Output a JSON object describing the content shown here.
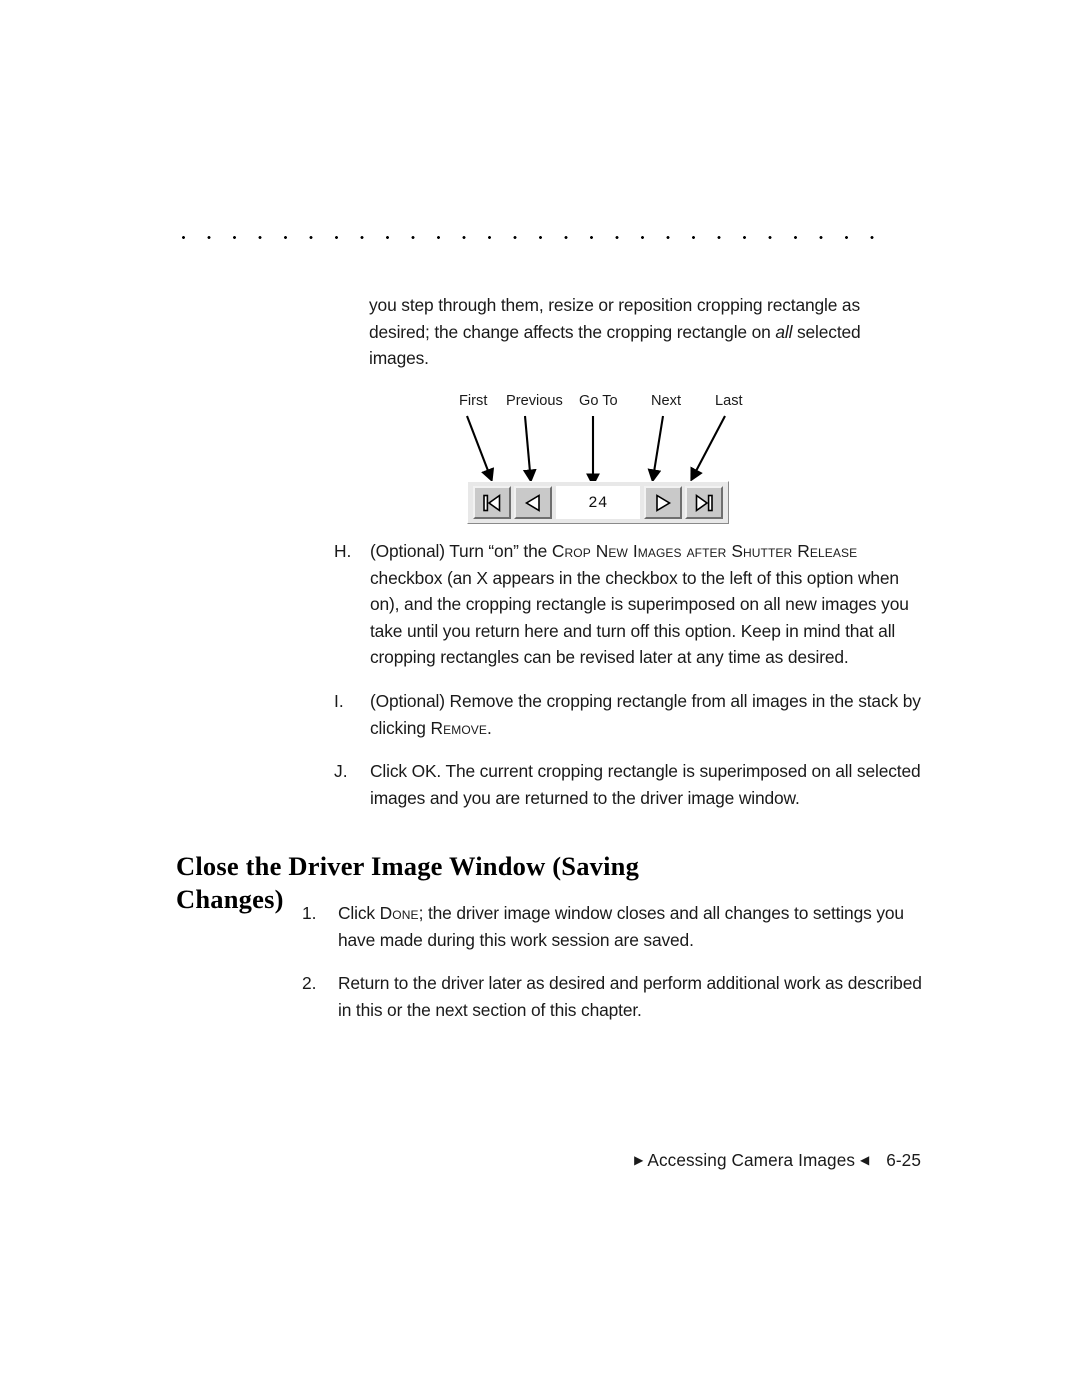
{
  "page": {
    "footer_prefix_icon": "triangle-right-icon",
    "footer_text": "Accessing Camera Images",
    "footer_suffix_icon": "triangle-left-icon",
    "page_number": "6-25"
  },
  "intro": {
    "line_1": "you step through them, resize or reposition cropping rectangle as",
    "line_2_a": "desired; the change affects the cropping rectangle on ",
    "line_2_em": "all",
    "line_2_b": " selected",
    "line_3": "images."
  },
  "figure": {
    "labels": [
      {
        "id": "first",
        "text": "First"
      },
      {
        "id": "previous",
        "text": "Previous"
      },
      {
        "id": "goto",
        "text": "Go To"
      },
      {
        "id": "next",
        "text": "Next"
      },
      {
        "id": "last",
        "text": "Last"
      }
    ],
    "toolbar": {
      "first_button_icon": "skip-to-first-icon",
      "previous_button_icon": "previous-triangle-icon",
      "counter_value": "24",
      "next_button_icon": "next-triangle-icon",
      "last_button_icon": "skip-to-last-icon"
    }
  },
  "letter_list": [
    {
      "marker": "H.",
      "part_1": "(Optional) Turn “on” the ",
      "smallcaps": "Crop New Images after Shutter Release",
      "part_2": " checkbox (an X appears in the checkbox to the left of this option when on), and the cropping rectangle is superimposed on all new images you take until you return here and turn off this option. Keep in mind that all cropping rectangles can be revised later at any time as desired."
    },
    {
      "marker": "I.",
      "part_1": "(Optional) Remove the cropping rectangle from all images in the stack by clicking ",
      "smallcaps": "Remove",
      "part_2": "."
    },
    {
      "marker": "J.",
      "part_1": "Click OK. The current cropping rectangle is superimposed on all selected images and you are returned to the driver image window.",
      "smallcaps": "",
      "part_2": ""
    }
  ],
  "heading": {
    "text": "Close the Driver Image Window (Saving Changes)"
  },
  "num_list": [
    {
      "marker": "1.",
      "part_1": "Click ",
      "smallcaps": "Done",
      "part_2": "; the driver image window closes and all changes to settings you have made during this work session are saved."
    },
    {
      "marker": "2.",
      "part_1": "Return to the driver later as desired and perform additional work as described in this or the next section of this chapter.",
      "smallcaps": "",
      "part_2": ""
    }
  ]
}
